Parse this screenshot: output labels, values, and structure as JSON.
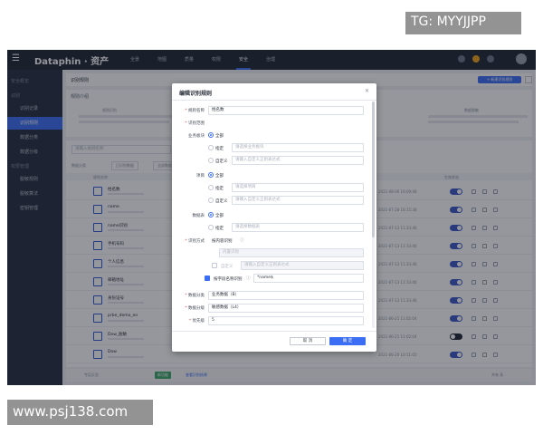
{
  "watermarks": {
    "top_right": "TG: MYYJJPP",
    "bottom_left": "www.psj138.com"
  },
  "topbar": {
    "brand": "Dataphin · 资产",
    "nav": [
      "全景",
      "地图",
      "质量",
      "权限",
      "安全",
      "治理"
    ],
    "active_nav": "安全"
  },
  "sidebar": {
    "groups": [
      {
        "label": "安全概览",
        "type": "group"
      },
      {
        "label": "识别",
        "type": "group"
      },
      {
        "label": "识别记录",
        "type": "item"
      },
      {
        "label": "识别规则",
        "type": "item",
        "active": true
      },
      {
        "label": "数据分类",
        "type": "item"
      },
      {
        "label": "数据分级",
        "type": "item"
      },
      {
        "label": "权限管理",
        "type": "group"
      },
      {
        "label": "脱敏规则",
        "type": "item"
      },
      {
        "label": "脱敏算法",
        "type": "item"
      },
      {
        "label": "密钥管理",
        "type": "item"
      }
    ]
  },
  "page": {
    "title": "识别规则",
    "intro_label": "规则介绍",
    "new_button": "+ 新建识别规则",
    "card_left_title": "规则识别",
    "card_right_title": "数据脱敏",
    "search_placeholder": "请输入规则名称",
    "filter_label": "数据分类",
    "chips": [
      "已识别数据",
      "全部数据"
    ],
    "table_header_name": "规则名称",
    "table_header_status": "生效状态",
    "rows": [
      {
        "name": "姓名数",
        "date": "2021-08-06 16:09:48",
        "on": true
      },
      {
        "name": "name",
        "date": "2021-07-28 16:15:38",
        "on": true
      },
      {
        "name": "name识别",
        "date": "2021-07-13 11:33:46",
        "on": true
      },
      {
        "name": "手机号码",
        "date": "2021-07-13 11:33:46",
        "on": true
      },
      {
        "name": "个人信息",
        "date": "2021-07-13 11:33:46",
        "on": true
      },
      {
        "name": "邮箱地址",
        "date": "2021-07-13 11:33:46",
        "on": true
      },
      {
        "name": "身份证号",
        "date": "2021-07-13 11:33:46",
        "on": true
      },
      {
        "name": "prbe_demo_en",
        "date": "2021-06-21 11:02:04",
        "on": true
      },
      {
        "name": "Dow_脱敏",
        "date": "2021-06-21 11:02:04",
        "on": false
      },
      {
        "name": "Dow",
        "date": "2021-06-20 10:11:05",
        "on": true
      }
    ],
    "footer_left": "专区反显",
    "footer_tag": "新功能",
    "footer_link": "查看识别结果",
    "footer_right": "共有 条"
  },
  "modal": {
    "title": "编辑识别规则",
    "name_label": "规则名称",
    "name_value": "姓名数",
    "scope_label": "识别范围",
    "biz_label": "业务板块",
    "project_label": "项目",
    "db_label": "数据表",
    "opt_all": "全部",
    "opt_specify": "指定",
    "opt_custom": "自定义",
    "specify_placeholder": "请选择业务板块",
    "custom_placeholder": "请输入自定义正则表达式",
    "project_specify_placeholder": "请选择项目",
    "db_specify_placeholder": "请选择数据表",
    "method_label": "识别方式",
    "method_value": "按内容识别",
    "content_disabled_1": "内置识别",
    "content_disabled_2": "自定义",
    "content_disabled_3": "请输入自定义正则表达式",
    "field_check_label": "按字段名称识别",
    "field_value": "*name$",
    "classify_label": "数据分类",
    "classify_value": "业务数据（B）",
    "level_label": "数据分级",
    "level_value": "敏感数据（L4）",
    "priority_label": "优先级",
    "priority_value": "5",
    "cancel": "取 消",
    "confirm": "确 定"
  }
}
